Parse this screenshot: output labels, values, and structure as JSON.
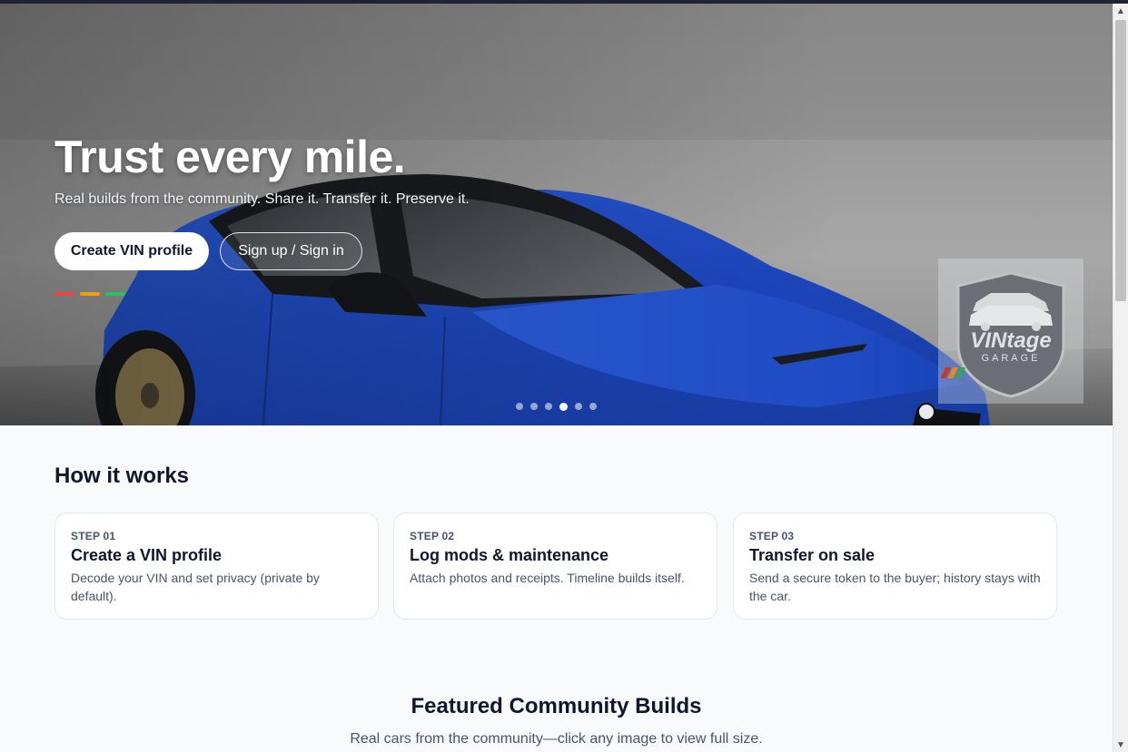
{
  "hero": {
    "title": "Trust every mile.",
    "subtitle": "Real builds from the community. Share it. Transfer it. Preserve it.",
    "primary_button": "Create VIN profile",
    "secondary_button": "Sign up / Sign in",
    "accent_stripes": [
      "#ef4444",
      "#f59e0b",
      "#22c55e"
    ],
    "carousel": {
      "total": 6,
      "active_index": 3
    },
    "badge": {
      "brand": "VINtage",
      "brand_sub": "GARAGE"
    },
    "car_color": "#1f4fd1"
  },
  "how_it_works": {
    "title": "How it works",
    "steps": [
      {
        "step": "STEP 01",
        "title": "Create a VIN profile",
        "desc": "Decode your VIN and set privacy (private by default)."
      },
      {
        "step": "STEP 02",
        "title": "Log mods & maintenance",
        "desc": "Attach photos and receipts. Timeline builds itself."
      },
      {
        "step": "STEP 03",
        "title": "Transfer on sale",
        "desc": "Send a secure token to the buyer; history stays with the car."
      }
    ]
  },
  "featured": {
    "title": "Featured Community Builds",
    "subtitle": "Real cars from the community—click any image to view full size."
  }
}
